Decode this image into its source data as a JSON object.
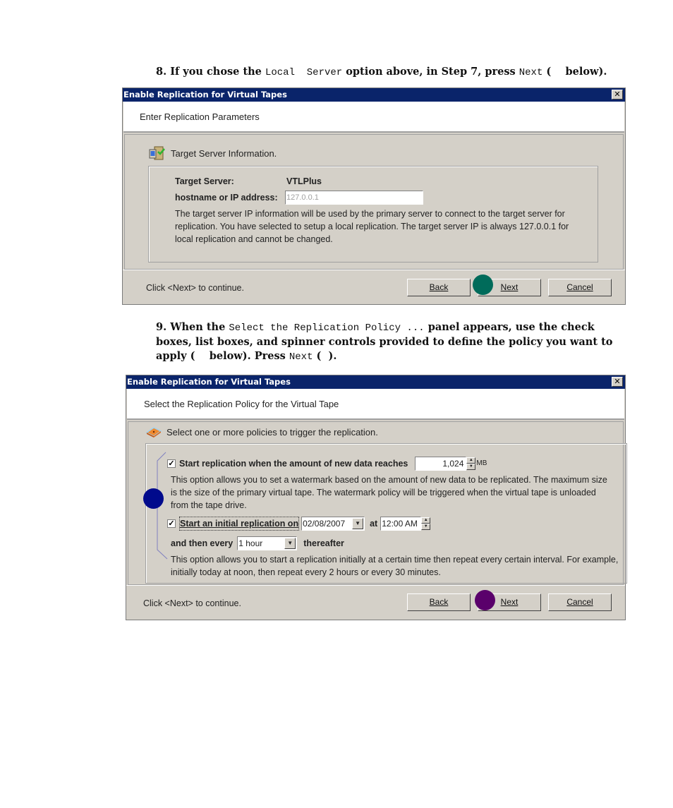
{
  "step8": {
    "number": "8.",
    "prefix": "If you chose the",
    "code": "Local  Server",
    "middle": "option above, in Step 7, press",
    "code2": "Next",
    "suffix": "(    below)."
  },
  "dialog1": {
    "title": "Enable Replication for Virtual Tapes",
    "close_icon": "close-icon",
    "header": "Enter Replication Parameters",
    "section_title": "Target Server Information.",
    "section_icon": "server-check-icon",
    "target_server_label": "Target Server:",
    "target_server_value": "VTLPlus",
    "ip_label": "hostname or IP address:",
    "ip_value": "127.0.0.1",
    "description": "The target server IP information will be used by the primary server to connect to the target server for replication. You have selected to setup a local replication. The target server IP is always 127.0.0.1 for local replication and cannot be changed.",
    "hint": "Click <Next> to continue.",
    "buttons": {
      "back": "Back",
      "next": "Next",
      "cancel": "Cancel"
    },
    "marker_color": "#006b5a"
  },
  "step9": {
    "number": "9.",
    "prefix": "When the",
    "code": "Select the Replication Policy ...",
    "middle": "panel appears, use the check boxes, list boxes, and spinner controls provided to define the policy you want to apply (    below). Press",
    "code2": "Next",
    "suffix": "(  )."
  },
  "dialog2": {
    "title": "Enable Replication for Virtual Tapes",
    "header": "Select the Replication Policy for the Virtual Tape",
    "section_title": "Select one or more policies to trigger the replication.",
    "section_icon": "tape-icon",
    "policy1": {
      "checked": true,
      "label": "Start replication when the amount of new data reaches",
      "value": "1,024",
      "unit": "MB",
      "description": "This option allows you to set a watermark based on the amount of new data to be replicated. The maximum size is the size of the primary virtual tape. The watermark policy will be triggered when the virtual tape is unloaded from the tape drive."
    },
    "policy2": {
      "checked": true,
      "label": "Start an initial replication on",
      "date": "02/08/2007",
      "at_label": "at",
      "time": "12:00 AM",
      "every_label": "and then every",
      "interval": "1 hour",
      "after_label": "thereafter",
      "description": "This option allows you to start a replication initially at a certain time then repeat every certain interval. For example, initially today at noon, then repeat every 2 hours or every 30 minutes."
    },
    "hint": "Click <Next> to continue.",
    "buttons": {
      "back": "Back",
      "next": "Next",
      "cancel": "Cancel"
    },
    "marker_blue": "#000a8c",
    "marker_purple": "#5a006b"
  }
}
